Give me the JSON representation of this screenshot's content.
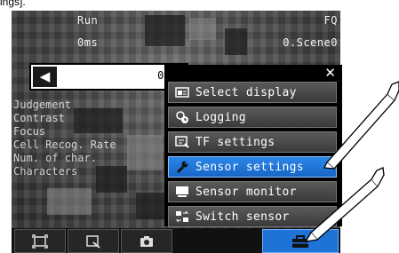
{
  "caption_fragment": "ings].",
  "status": {
    "mode": "Run",
    "mode_right": "FQ",
    "time": "0ms",
    "scene": "0.Scene0"
  },
  "nav": {
    "prev_icon": "left-triangle-icon",
    "value": "0.2("
  },
  "measure_items": [
    "Judgement",
    "Contrast",
    "Focus",
    "Cell Recog. Rate",
    "Num. of char.",
    "Characters"
  ],
  "menu": {
    "close_icon": "close-icon",
    "items": [
      {
        "label": "Select display",
        "icon": "display-icon",
        "selected": false
      },
      {
        "label": "Logging",
        "icon": "logging-icon",
        "selected": false
      },
      {
        "label": "TF settings",
        "icon": "tf-settings-icon",
        "selected": false
      },
      {
        "label": "Sensor settings",
        "icon": "wrench-icon",
        "selected": true
      },
      {
        "label": "Sensor monitor",
        "icon": "monitor-icon",
        "selected": false
      },
      {
        "label": "Switch sensor",
        "icon": "switch-icon",
        "selected": false
      }
    ]
  },
  "toolbar": {
    "buttons": [
      {
        "icon": "fit-frame-icon"
      },
      {
        "icon": "zoom-icon"
      },
      {
        "icon": "camera-icon"
      },
      {
        "icon": "toolbox-icon",
        "active": true
      }
    ]
  },
  "colors": {
    "selected": "#1f73d6",
    "menu_bg": "#000000",
    "screen_bg": "#3b3b3b"
  }
}
